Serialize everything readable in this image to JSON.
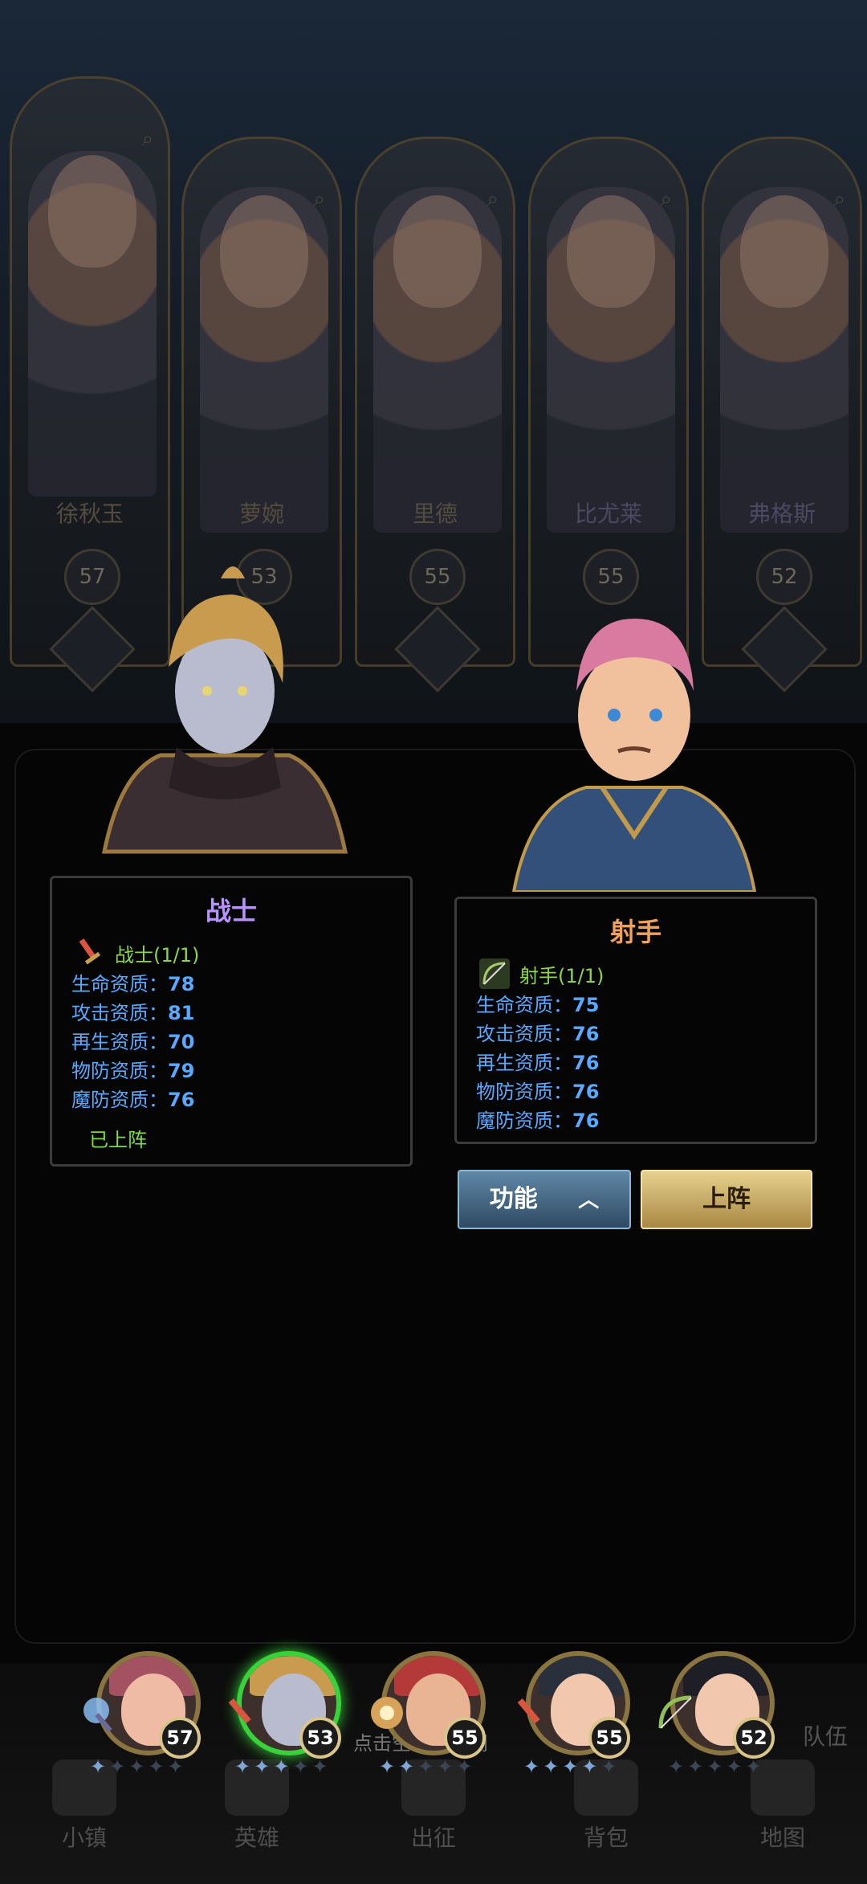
{
  "heroes": [
    {
      "name": "徐秋玉",
      "level": "57",
      "class_icon": "orb-staff-icon"
    },
    {
      "name": "萝婉",
      "level": "53",
      "class_icon": "sword-icon"
    },
    {
      "name": "里德",
      "level": "55",
      "class_icon": "priest-emblem-icon"
    },
    {
      "name": "比尤莱",
      "level": "55",
      "class_icon": "sword-icon"
    },
    {
      "name": "弗格斯",
      "level": "52",
      "class_icon": "bow-icon"
    }
  ],
  "selected_left": {
    "title": "战士",
    "class_label": "战士(1/1)",
    "class_icon": "sword-icon",
    "stats": [
      {
        "label": "生命资质：",
        "value": "78"
      },
      {
        "label": "攻击资质：",
        "value": "81"
      },
      {
        "label": "再生资质：",
        "value": "70"
      },
      {
        "label": "物防资质：",
        "value": "79"
      },
      {
        "label": "魔防资质：",
        "value": "76"
      }
    ],
    "status": "已上阵"
  },
  "selected_right": {
    "title": "射手",
    "class_label": "射手(1/1)",
    "class_icon": "bow-icon",
    "stats": [
      {
        "label": "生命资质：",
        "value": "75"
      },
      {
        "label": "攻击资质：",
        "value": "76"
      },
      {
        "label": "再生资质：",
        "value": "76"
      },
      {
        "label": "物防资质：",
        "value": "76"
      },
      {
        "label": "魔防资质：",
        "value": "76"
      }
    ]
  },
  "buttons": {
    "function": "功能",
    "deploy": "上阵"
  },
  "team": [
    {
      "level": "57",
      "stars_lit": 1,
      "stars_total": 5
    },
    {
      "level": "53",
      "stars_lit": 3,
      "stars_total": 5
    },
    {
      "level": "55",
      "stars_lit": 2,
      "stars_total": 5
    },
    {
      "level": "55",
      "stars_lit": 4,
      "stars_total": 5
    },
    {
      "level": "52",
      "stars_lit": 0,
      "stars_total": 5
    }
  ],
  "bottom_nav": [
    "小镇",
    "英雄",
    "出征",
    "背包",
    "地图"
  ],
  "team_side_label": "队伍",
  "hint_text": "点击空白处关闭",
  "colors": {
    "title_purple": "#b892ff",
    "title_orange": "#f2a15b",
    "stat_blue": "#5aa9ff",
    "class_green": "#8bd64a"
  }
}
